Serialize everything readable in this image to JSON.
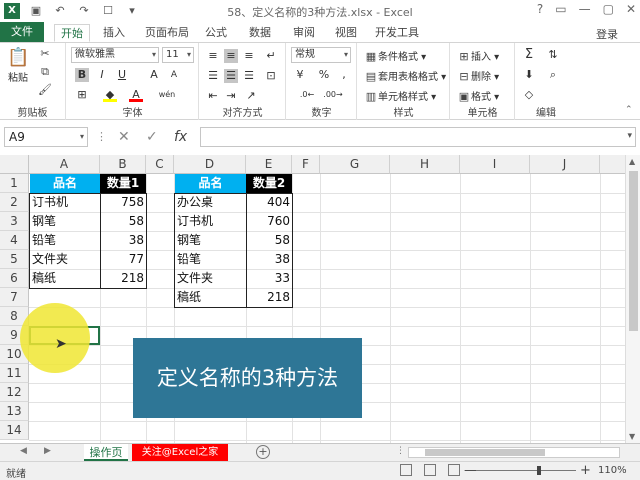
{
  "app": {
    "title": "58、定义名称的3种方法.xlsx - Excel",
    "window_controls": [
      "?",
      "▭",
      "—",
      "▢",
      "✕"
    ],
    "login": "登录"
  },
  "tabs": [
    "文件",
    "开始",
    "插入",
    "页面布局",
    "公式",
    "数据",
    "审阅",
    "视图",
    "开发工具"
  ],
  "ribbon": {
    "clipboard": {
      "paste": "粘贴",
      "label": "剪贴板"
    },
    "font": {
      "name": "微软雅黑",
      "size": "11",
      "label": "字体",
      "bold": "B",
      "italic": "I",
      "underline": "U",
      "grow": "A",
      "shrink": "A",
      "color_a": "A",
      "wen": "wén"
    },
    "alignment": {
      "label": "对齐方式"
    },
    "number": {
      "format": "常规",
      "label": "数字",
      "percent": "%",
      "comma": ","
    },
    "styles": {
      "cond": "条件格式",
      "table": "套用表格格式",
      "cell": "单元格样式",
      "label": "样式"
    },
    "cells": {
      "insert": "插入",
      "delete": "删除",
      "format": "格式",
      "label": "单元格"
    },
    "editing": {
      "label": "编辑",
      "sigma": "Σ"
    }
  },
  "formula_bar": {
    "name_box": "A9",
    "value": "",
    "cancel": "✕",
    "enter": "✓",
    "fx": "fx"
  },
  "grid": {
    "columns": [
      "A",
      "B",
      "C",
      "D",
      "E",
      "F",
      "G",
      "H",
      "I",
      "J"
    ],
    "rows": [
      "1",
      "2",
      "3",
      "4",
      "5",
      "6",
      "7",
      "8",
      "9",
      "10",
      "11",
      "12",
      "13",
      "14"
    ],
    "table1": {
      "headers": [
        "品名",
        "数量1"
      ],
      "rows": [
        [
          "订书机",
          "758"
        ],
        [
          "钢笔",
          "58"
        ],
        [
          "铅笔",
          "38"
        ],
        [
          "文件夹",
          "77"
        ],
        [
          "稿纸",
          "218"
        ]
      ]
    },
    "table2": {
      "headers": [
        "品名",
        "数量2"
      ],
      "rows": [
        [
          "办公桌",
          "404"
        ],
        [
          "订书机",
          "760"
        ],
        [
          "钢笔",
          "58"
        ],
        [
          "铅笔",
          "38"
        ],
        [
          "文件夹",
          "33"
        ],
        [
          "稿纸",
          "218"
        ]
      ]
    }
  },
  "banner": "定义名称的3种方法",
  "sheets": [
    "操作页",
    "关注@Excel之家"
  ],
  "status": {
    "ready": "就绪",
    "zoom": "110%",
    "minus": "—",
    "plus": "+"
  },
  "colors": {
    "accent": "#217346",
    "header": "#00b0f0",
    "banner": "#2e7696"
  }
}
